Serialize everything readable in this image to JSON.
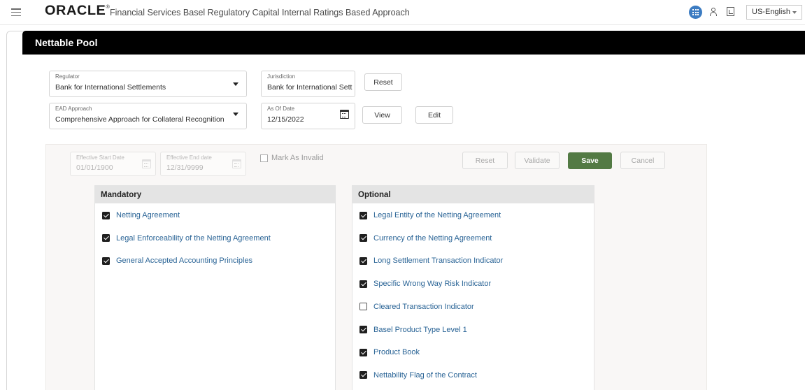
{
  "header": {
    "logo_text": "ORACLE",
    "logo_mark": "®",
    "app_title": "Financial Services Basel Regulatory Capital Internal Ratings Based Approach",
    "language": "US-English",
    "icons": [
      "hamburger-menu-icon",
      "apps-grid-icon",
      "user-icon",
      "document-icon"
    ]
  },
  "page": {
    "title": "Nettable Pool"
  },
  "filters": {
    "regulator": {
      "label": "Regulator",
      "value": "Bank for International Settlements"
    },
    "jurisdiction": {
      "label": "Jurisdiction",
      "value": "Bank for International Settlements"
    },
    "ead_approach": {
      "label": "EAD Approach",
      "value": "Comprehensive Approach for Collateral Recognition"
    },
    "as_of_date": {
      "label": "As Of Date",
      "value": "12/15/2022"
    },
    "reset_label": "Reset",
    "view_label": "View",
    "edit_label": "Edit"
  },
  "form": {
    "effective_start": {
      "label": "Effective Start Date",
      "value": "01/01/1900"
    },
    "effective_end": {
      "label": "Effective End date",
      "value": "12/31/9999"
    },
    "mark_invalid_label": "Mark As Invalid",
    "reset_label": "Reset",
    "validate_label": "Validate",
    "save_label": "Save",
    "cancel_label": "Cancel",
    "accent_color": "#537a44"
  },
  "mandatory": {
    "title": "Mandatory",
    "items": [
      {
        "label": "Netting Agreement",
        "checked": true
      },
      {
        "label": "Legal Enforceability of the Netting Agreement",
        "checked": true
      },
      {
        "label": "General Accepted Accounting Principles",
        "checked": true
      }
    ]
  },
  "optional": {
    "title": "Optional",
    "items": [
      {
        "label": "Legal Entity of the Netting Agreement",
        "checked": true
      },
      {
        "label": "Currency of the Netting Agreement",
        "checked": true
      },
      {
        "label": "Long Settlement Transaction Indicator",
        "checked": true
      },
      {
        "label": "Specific Wrong Way Risk Indicator",
        "checked": true
      },
      {
        "label": "Cleared Transaction Indicator",
        "checked": false
      },
      {
        "label": "Basel Product Type Level 1",
        "checked": true
      },
      {
        "label": "Product Book",
        "checked": true
      },
      {
        "label": "Nettability Flag of the  Contract",
        "checked": true
      }
    ]
  }
}
